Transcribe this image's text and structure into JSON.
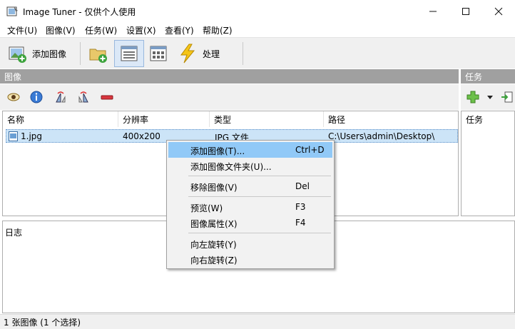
{
  "window": {
    "title": "Image Tuner - 仅供个人使用",
    "controls": [
      "minimize-icon",
      "maximize-icon",
      "close-icon"
    ]
  },
  "menubar": [
    "文件(U)",
    "图像(V)",
    "任务(W)",
    "设置(X)",
    "查看(Y)",
    "帮助(Z)"
  ],
  "toolbar": {
    "add_image_label": "添加图像",
    "process_label": "处理",
    "icons": [
      "add-image-icon",
      "add-folder-icon",
      "details-view-icon",
      "thumbnail-view-icon",
      "process-icon"
    ]
  },
  "images_panel": {
    "header": "图像",
    "toolbar_icons": [
      "preview-icon",
      "info-icon",
      "rotate-left-icon",
      "rotate-right-icon",
      "remove-icon"
    ],
    "columns": [
      "名称",
      "分辨率",
      "类型",
      "路径"
    ],
    "rows": [
      {
        "name": "1.jpg",
        "resolution": "400x200",
        "type": "JPG 文件",
        "path": "C:\\Users\\admin\\Desktop\\"
      }
    ]
  },
  "tasks_panel": {
    "header": "任务",
    "column": "任务",
    "toolbar_icons": [
      "add-task-icon",
      "dropdown-arrow-icon",
      "export-icon"
    ]
  },
  "log": {
    "label": "日志"
  },
  "statusbar": {
    "text": "1 张图像 (1 个选择)"
  },
  "context_menu": {
    "items": [
      {
        "label": "添加图像(T)...",
        "shortcut": "Ctrl+D",
        "highlighted": true
      },
      {
        "label": "添加图像文件夹(U)...",
        "shortcut": ""
      },
      {
        "label": "移除图像(V)",
        "shortcut": "Del"
      },
      {
        "label": "预览(W)",
        "shortcut": "F3"
      },
      {
        "label": "图像属性(X)",
        "shortcut": "F4"
      },
      {
        "label": "向左旋转(Y)",
        "shortcut": ""
      },
      {
        "label": "向右旋转(Z)",
        "shortcut": ""
      }
    ]
  },
  "colors": {
    "selection": "#cce4f7",
    "menu_highlight": "#91c9f7",
    "panel_header": "#a0a0a0",
    "add_icon_green": "#3da33d",
    "remove_icon_red": "#d9363e",
    "process_icon_yellow": "#f5c518"
  }
}
